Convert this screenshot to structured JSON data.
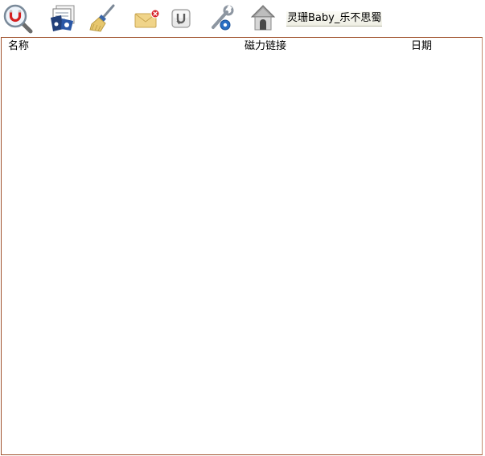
{
  "toolbar": {
    "buttons": [
      {
        "name": "magnet-search",
        "icon": "magnet-magnifier-icon"
      },
      {
        "name": "downloads",
        "icon": "document-stack-icon"
      },
      {
        "name": "clear",
        "icon": "broom-icon"
      },
      {
        "name": "delete-message",
        "icon": "envelope-delete-icon"
      },
      {
        "name": "magnet-link",
        "icon": "magnet-badge-icon"
      },
      {
        "name": "settings",
        "icon": "wrench-gear-icon"
      },
      {
        "name": "home",
        "icon": "house-icon"
      }
    ],
    "user_label": "灵珊Baby_乐不思蜀"
  },
  "list": {
    "columns": [
      "名称",
      "磁力链接",
      "日期"
    ],
    "rows": []
  }
}
